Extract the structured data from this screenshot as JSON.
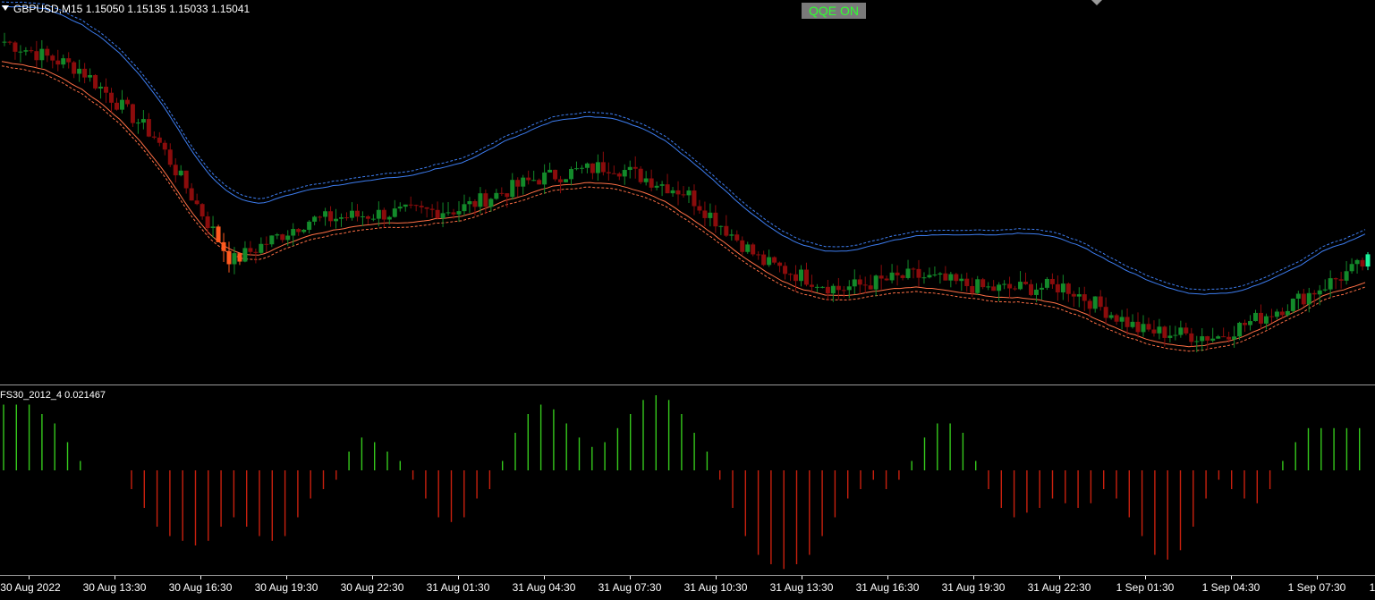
{
  "header": {
    "symbol_info": "GBPUSD,M15  1.15050 1.15135 1.15033 1.15041",
    "qqe_button": "QQE ON"
  },
  "sub_window": {
    "indicator_label": "FS30_2012_4 0.021467"
  },
  "colors": {
    "background": "#000000",
    "bull_bright": "#1bf29a",
    "bull_dark": "#138a2a",
    "bear_bright": "#ff5a1f",
    "bear_dark": "#8b0c0c",
    "upper_band": "#3d7df0",
    "lower_band": "#ff6f45",
    "hist_positive": "#35c81c",
    "hist_negative": "#c8200e"
  },
  "time_axis": {
    "labels": [
      "30 Aug 2022",
      "30 Aug 13:30",
      "30 Aug 16:30",
      "30 Aug 19:30",
      "30 Aug 22:30",
      "31 Aug 01:30",
      "31 Aug 04:30",
      "31 Aug 07:30",
      "31 Aug 10:30",
      "31 Aug 13:30",
      "31 Aug 16:30",
      "31 Aug 19:30",
      "31 Aug 22:30",
      "1 Sep 01:30",
      "1 Sep 04:30",
      "1 Sep 07:30",
      "1"
    ]
  },
  "chart_data": [
    {
      "type": "candlestick",
      "title": "GBPUSD,M15",
      "last_bar": {
        "open": 1.1505,
        "high": 1.15135,
        "low": 1.15033,
        "close": 1.15041
      },
      "price_trend": [
        1.16,
        1.158,
        1.153,
        1.144,
        1.147,
        1.1475,
        1.1478,
        1.15,
        1.151,
        1.149,
        1.144,
        1.142,
        1.143,
        1.142,
        1.1422,
        1.139,
        1.1385,
        1.141,
        1.144
      ],
      "series": [
        {
          "name": "upper band",
          "style": "solid + dashed",
          "color": "#3d7df0"
        },
        {
          "name": "lower band",
          "style": "solid + dashed",
          "color": "#ff6f45"
        }
      ]
    },
    {
      "type": "bar",
      "title": "FS30_2012_4",
      "last_value": 0.021467,
      "values": [
        0.7,
        0.7,
        0.7,
        0.6,
        0.5,
        0.3,
        0.1,
        0.0,
        0.0,
        0.0,
        -0.2,
        -0.4,
        -0.6,
        -0.7,
        -0.75,
        -0.8,
        -0.75,
        -0.6,
        -0.5,
        -0.6,
        -0.7,
        -0.75,
        -0.7,
        -0.5,
        -0.3,
        -0.2,
        -0.1,
        0.2,
        0.35,
        0.3,
        0.2,
        0.1,
        -0.1,
        -0.3,
        -0.5,
        -0.55,
        -0.5,
        -0.3,
        -0.2,
        0.1,
        0.4,
        0.6,
        0.7,
        0.65,
        0.5,
        0.35,
        0.25,
        0.3,
        0.45,
        0.6,
        0.75,
        0.8,
        0.75,
        0.6,
        0.4,
        0.2,
        -0.1,
        -0.4,
        -0.7,
        -0.9,
        -1.0,
        -1.05,
        -1.0,
        -0.9,
        -0.7,
        -0.5,
        -0.3,
        -0.2,
        -0.1,
        -0.2,
        -0.1,
        0.1,
        0.35,
        0.5,
        0.5,
        0.4,
        0.1,
        -0.2,
        -0.4,
        -0.5,
        -0.45,
        -0.4,
        -0.3,
        -0.35,
        -0.4,
        -0.35,
        -0.2,
        -0.3,
        -0.5,
        -0.7,
        -0.9,
        -0.95,
        -0.85,
        -0.6,
        -0.3,
        -0.1,
        -0.2,
        -0.3,
        -0.35,
        -0.2,
        0.1,
        0.3,
        0.45,
        0.45,
        0.45,
        0.45,
        0.45
      ]
    }
  ]
}
